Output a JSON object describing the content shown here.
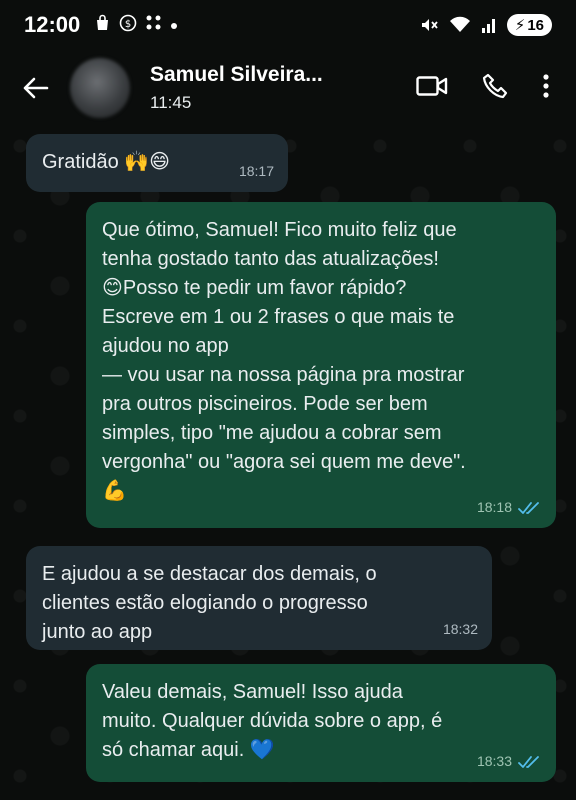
{
  "status_bar": {
    "time": "12:00",
    "left_icons": [
      "shopping-bag-icon",
      "wechat-icon",
      "grid-icon",
      "dot-icon"
    ],
    "battery": "16"
  },
  "header": {
    "contact_name": "Samuel Silveira...",
    "subtitle": "11:45"
  },
  "messages": [
    {
      "direction": "in",
      "text": "Gratidão 🙌😄",
      "time": "18:17"
    },
    {
      "direction": "out",
      "text": "Que ótimo, Samuel! Fico muito feliz que\ntenha gostado tanto das atualizações!\n😊Posso te pedir um favor rápido?\nEscreve em 1 ou 2 frases o que mais te\najudou no app\n— vou usar na nossa página pra mostrar\npra outros piscineiros. Pode ser bem\nsimples, tipo \"me ajudou a cobrar sem\nvergonha\" ou \"agora sei quem me deve\".\n💪",
      "time": "18:18",
      "ticks": "read"
    },
    {
      "direction": "in",
      "text": "E ajudou a se destacar dos demais, o\nclientes estão elogiando o progresso\njunto ao app",
      "time": "18:32"
    },
    {
      "direction": "out",
      "text": "Valeu demais, Samuel! Isso ajuda\nmuito. Qualquer dúvida sobre o app, é\nsó chamar aqui. 💙",
      "time": "18:33",
      "ticks": "read"
    }
  ],
  "colors": {
    "background": "#0b0d0c",
    "incoming_bubble": "#202c33",
    "outgoing_bubble": "#144d37",
    "read_ticks": "#53bdeb"
  }
}
